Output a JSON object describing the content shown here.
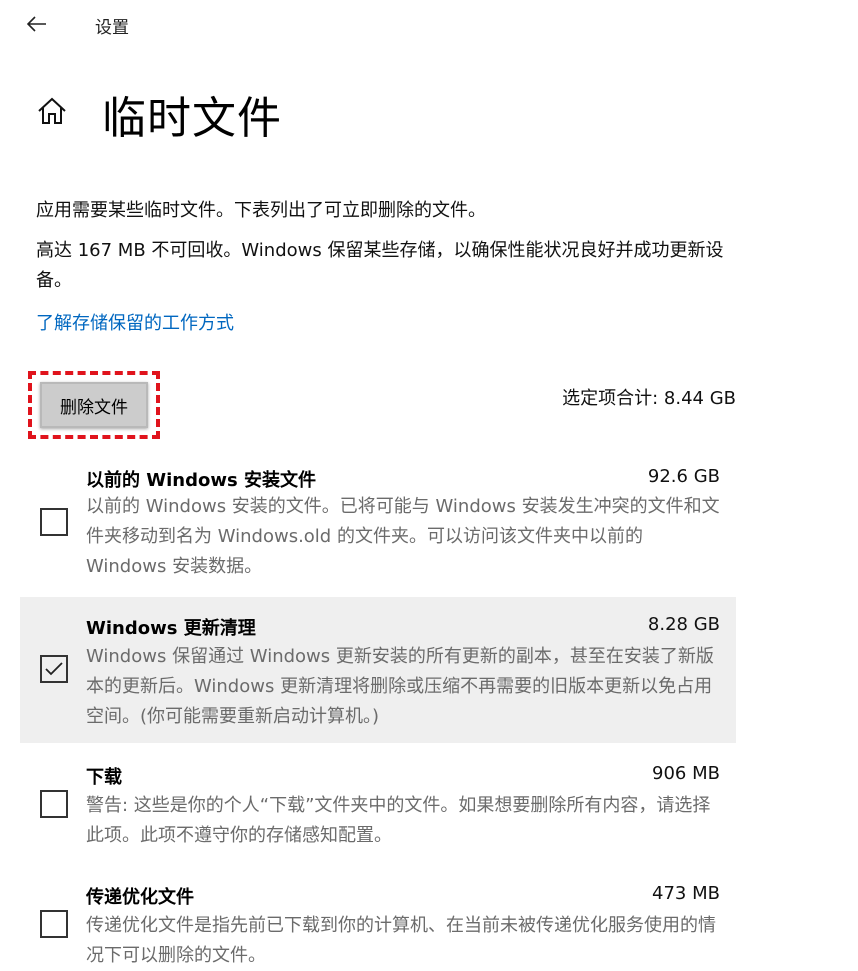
{
  "window": {
    "title": "设置"
  },
  "page": {
    "title": "临时文件"
  },
  "description": {
    "line1": "应用需要某些临时文件。下表列出了可立即删除的文件。",
    "line2": "高达 167 MB 不可回收。Windows 保留某些存储，以确保性能状况良好并成功更新设备。"
  },
  "learn_link": "了解存储保留的工作方式",
  "delete_button": "删除文件",
  "selected_total": "选定项合计: 8.44 GB",
  "items": [
    {
      "title": "以前的 Windows 安装文件",
      "size": "92.6 GB",
      "checked": false,
      "desc": "以前的 Windows 安装的文件。已将可能与 Windows 安装发生冲突的文件和文件夹移动到名为 Windows.old 的文件夹。可以访问该文件夹中以前的 Windows 安装数据。"
    },
    {
      "title": "Windows 更新清理",
      "size": "8.28 GB",
      "checked": true,
      "desc": "Windows 保留通过 Windows 更新安装的所有更新的副本，甚至在安装了新版本的更新后。Windows 更新清理将删除或压缩不再需要的旧版本更新以免占用空间。(你可能需要重新启动计算机。)"
    },
    {
      "title": "下载",
      "size": "906 MB",
      "checked": false,
      "desc": "警告: 这些是你的个人“下载”文件夹中的文件。如果想要删除所有内容，请选择此项。此项不遵守你的存储感知配置。"
    },
    {
      "title": "传递优化文件",
      "size": "473 MB",
      "checked": false,
      "desc": "传递优化文件是指先前已下载到你的计算机、在当前未被传递优化服务使用的情况下可以删除的文件。"
    }
  ],
  "icons": {
    "back": "back-arrow-icon",
    "home": "home-icon",
    "check": "checkmark-icon"
  }
}
